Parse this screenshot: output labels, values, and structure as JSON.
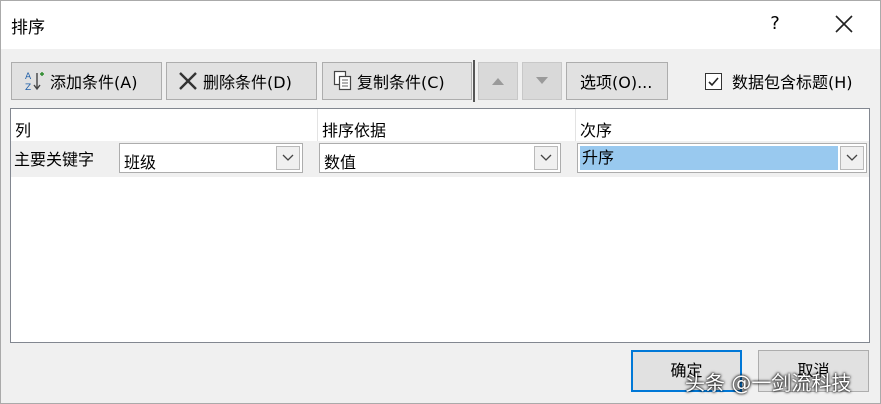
{
  "dialog": {
    "title": "排序",
    "help_glyph": "?"
  },
  "toolbar": {
    "add_label": "添加条件(A)",
    "delete_label": "删除条件(D)",
    "copy_label": "复制条件(C)",
    "options_label": "选项(O)...",
    "header_checkbox_label": "数据包含标题(H)",
    "header_checkbox_checked": true
  },
  "grid": {
    "headers": {
      "column": "列",
      "sort_on": "排序依据",
      "order": "次序"
    },
    "rows": [
      {
        "label": "主要关键字",
        "column": "班级",
        "sort_on": "数值",
        "order": "升序"
      }
    ]
  },
  "footer": {
    "ok_label": "确定",
    "cancel_label": "取消"
  },
  "watermark": "头条 @一剑流科技",
  "colors": {
    "selection": "#99c9ef",
    "focus_border": "#0078d7"
  },
  "icons": [
    "sort-az-icon",
    "delete-x-icon",
    "copy-icon",
    "move-up-icon",
    "move-down-icon",
    "checkmark-icon",
    "chevron-down-icon",
    "close-icon"
  ]
}
